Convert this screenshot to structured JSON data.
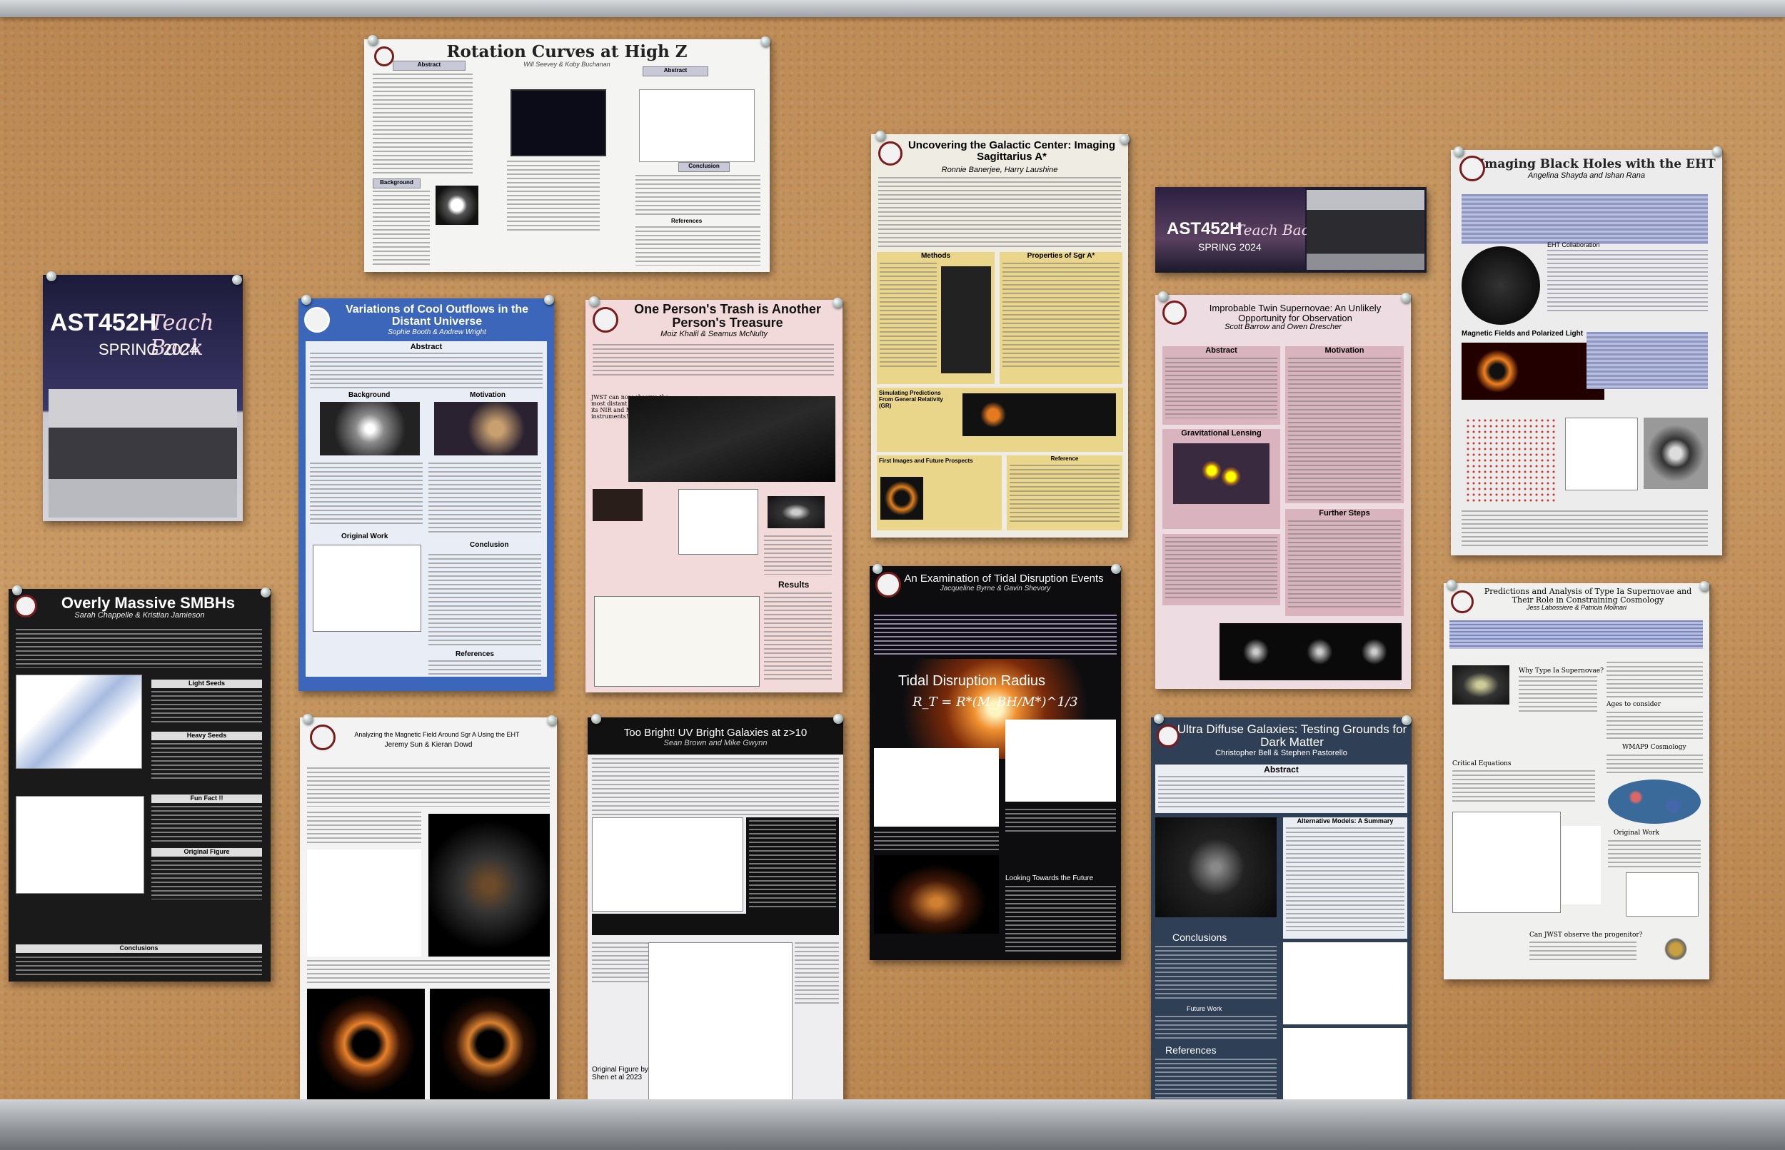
{
  "posters": {
    "rotation": {
      "title": "Rotation Curves at High Z",
      "authors": "Will Seevey & Koby Buchanan",
      "sections": [
        "Abstract",
        "Background",
        "Abstract",
        "Conclusion",
        "References"
      ]
    },
    "teachback_left": {
      "title": "AST452H",
      "subtitle": "Teach Back",
      "term": "SPRING 2024"
    },
    "teachback_right": {
      "title": "AST452H",
      "subtitle": "Teach Back",
      "term": "SPRING 2024"
    },
    "outflows": {
      "title": "Variations of Cool Outflows in the Distant Universe",
      "authors": "Sophie Booth & Andrew Wright",
      "sections": [
        "Abstract",
        "Background",
        "Motivation",
        "Original Work",
        "Conclusion",
        "References"
      ]
    },
    "trash": {
      "title": "One Person's Trash is Another Person's Treasure",
      "authors": "Moiz Khalil & Seamus McNulty",
      "callout": "JWST can now observe the most distant galaxies, using its NIR and MIR instruments!",
      "results": "Results"
    },
    "galactic_center": {
      "title": "Uncovering the Galactic Center: Imaging Sagittarius A*",
      "authors": "Ronnie Banerjee, Harry Laushine",
      "sections": [
        "Methods",
        "Properties of Sgr A*",
        "Simulating Predictions From General Relativity (GR)",
        "First Images and Future Prospects",
        "Reference"
      ]
    },
    "twin_sn": {
      "title": "Improbable Twin Supernovae: An Unlikely Opportunity for Observation",
      "authors": "Scott Barrow and Owen Drescher",
      "sections": [
        "Abstract",
        "Motivation",
        "Gravitational Lensing",
        "Further Steps"
      ]
    },
    "eht": {
      "title": "Imaging Black Holes with the EHT",
      "authors": "Angelina Shayda and Ishan Rana",
      "sections": [
        "EHT Collaboration",
        "Magnetic Fields and Polarized Light"
      ]
    },
    "smbh": {
      "title": "Overly Massive SMBHs",
      "authors": "Sarah Chappelle & Kristian Jamieson",
      "sections": [
        "Light Seeds",
        "Heavy Seeds",
        "Fun Fact !!",
        "Original Figure",
        "Conclusions"
      ]
    },
    "sgr_field": {
      "title": "Analyzing the Magnetic Field Around Sgr A Using the EHT",
      "authors": "Jeremy Sun & Kieran Dowd"
    },
    "uv_bright": {
      "title": "Too Bright! UV Bright Galaxies at z>10",
      "authors": "Sean Brown and Mike Gwynn",
      "caption": "Original Figure by Shen et al 2023"
    },
    "tidal": {
      "title": "An Examination of Tidal Disruption Events",
      "authors": "Jacqueline Byrne & Gavin Shevory",
      "radius_heading": "Tidal Disruption Radius",
      "formula": "R_T = R*(M_BH/M*)^1/3",
      "future": "Looking Towards the Future"
    },
    "udg": {
      "title": "Ultra Diffuse Galaxies: Testing Grounds for Dark Matter",
      "authors": "Christopher Bell & Stephen Pastorello",
      "sections": [
        "Abstract",
        "Alternative Models: A Summary",
        "Conclusions",
        "Future Work",
        "References"
      ]
    },
    "type1a": {
      "title": "Predictions and Analysis of Type Ia Supernovae and Their Role in Constraining Cosmology",
      "authors": "Jess Labossiere & Patricia Molinari",
      "sections": [
        "Why Type Ia Supernovae?",
        "Ages to consider",
        "WMAP9 Cosmology",
        "Critical Equations",
        "Original Work",
        "Can JWST observe the progenitor?"
      ]
    }
  },
  "colors": {
    "cork": "#c4925a",
    "frame": "#a8acb0",
    "crimson": "#7a1c1c",
    "navy": "#1f3f8a"
  }
}
